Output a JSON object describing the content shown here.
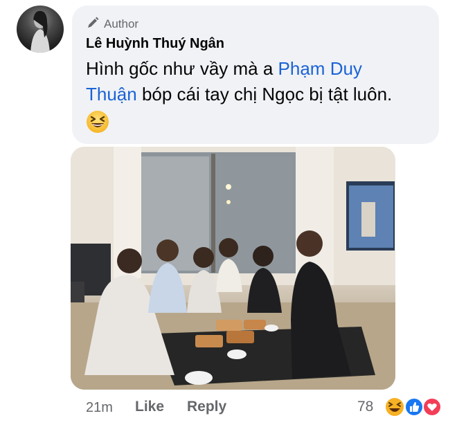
{
  "comment": {
    "author_badge": "Author",
    "author_name": "Lê Huỳnh Thuý Ngân",
    "text_before": "Hình gốc như vầy mà a ",
    "mention": "Phạm Duy Thuận",
    "text_after": " bóp cái tay chị Ngọc bị tật luôn.",
    "emoji": "grinning-squinting-face"
  },
  "footer": {
    "time": "21m",
    "like_label": "Like",
    "reply_label": "Reply",
    "reaction_count": "78",
    "reactions": [
      "haha",
      "like",
      "love"
    ]
  },
  "colors": {
    "bubble_bg": "#f0f2f5",
    "mention": "#1b63d6",
    "secondary_text": "#65676b",
    "like_blue": "#1877f2",
    "love_red": "#f33e58",
    "haha_yellow": "#f7b125"
  }
}
